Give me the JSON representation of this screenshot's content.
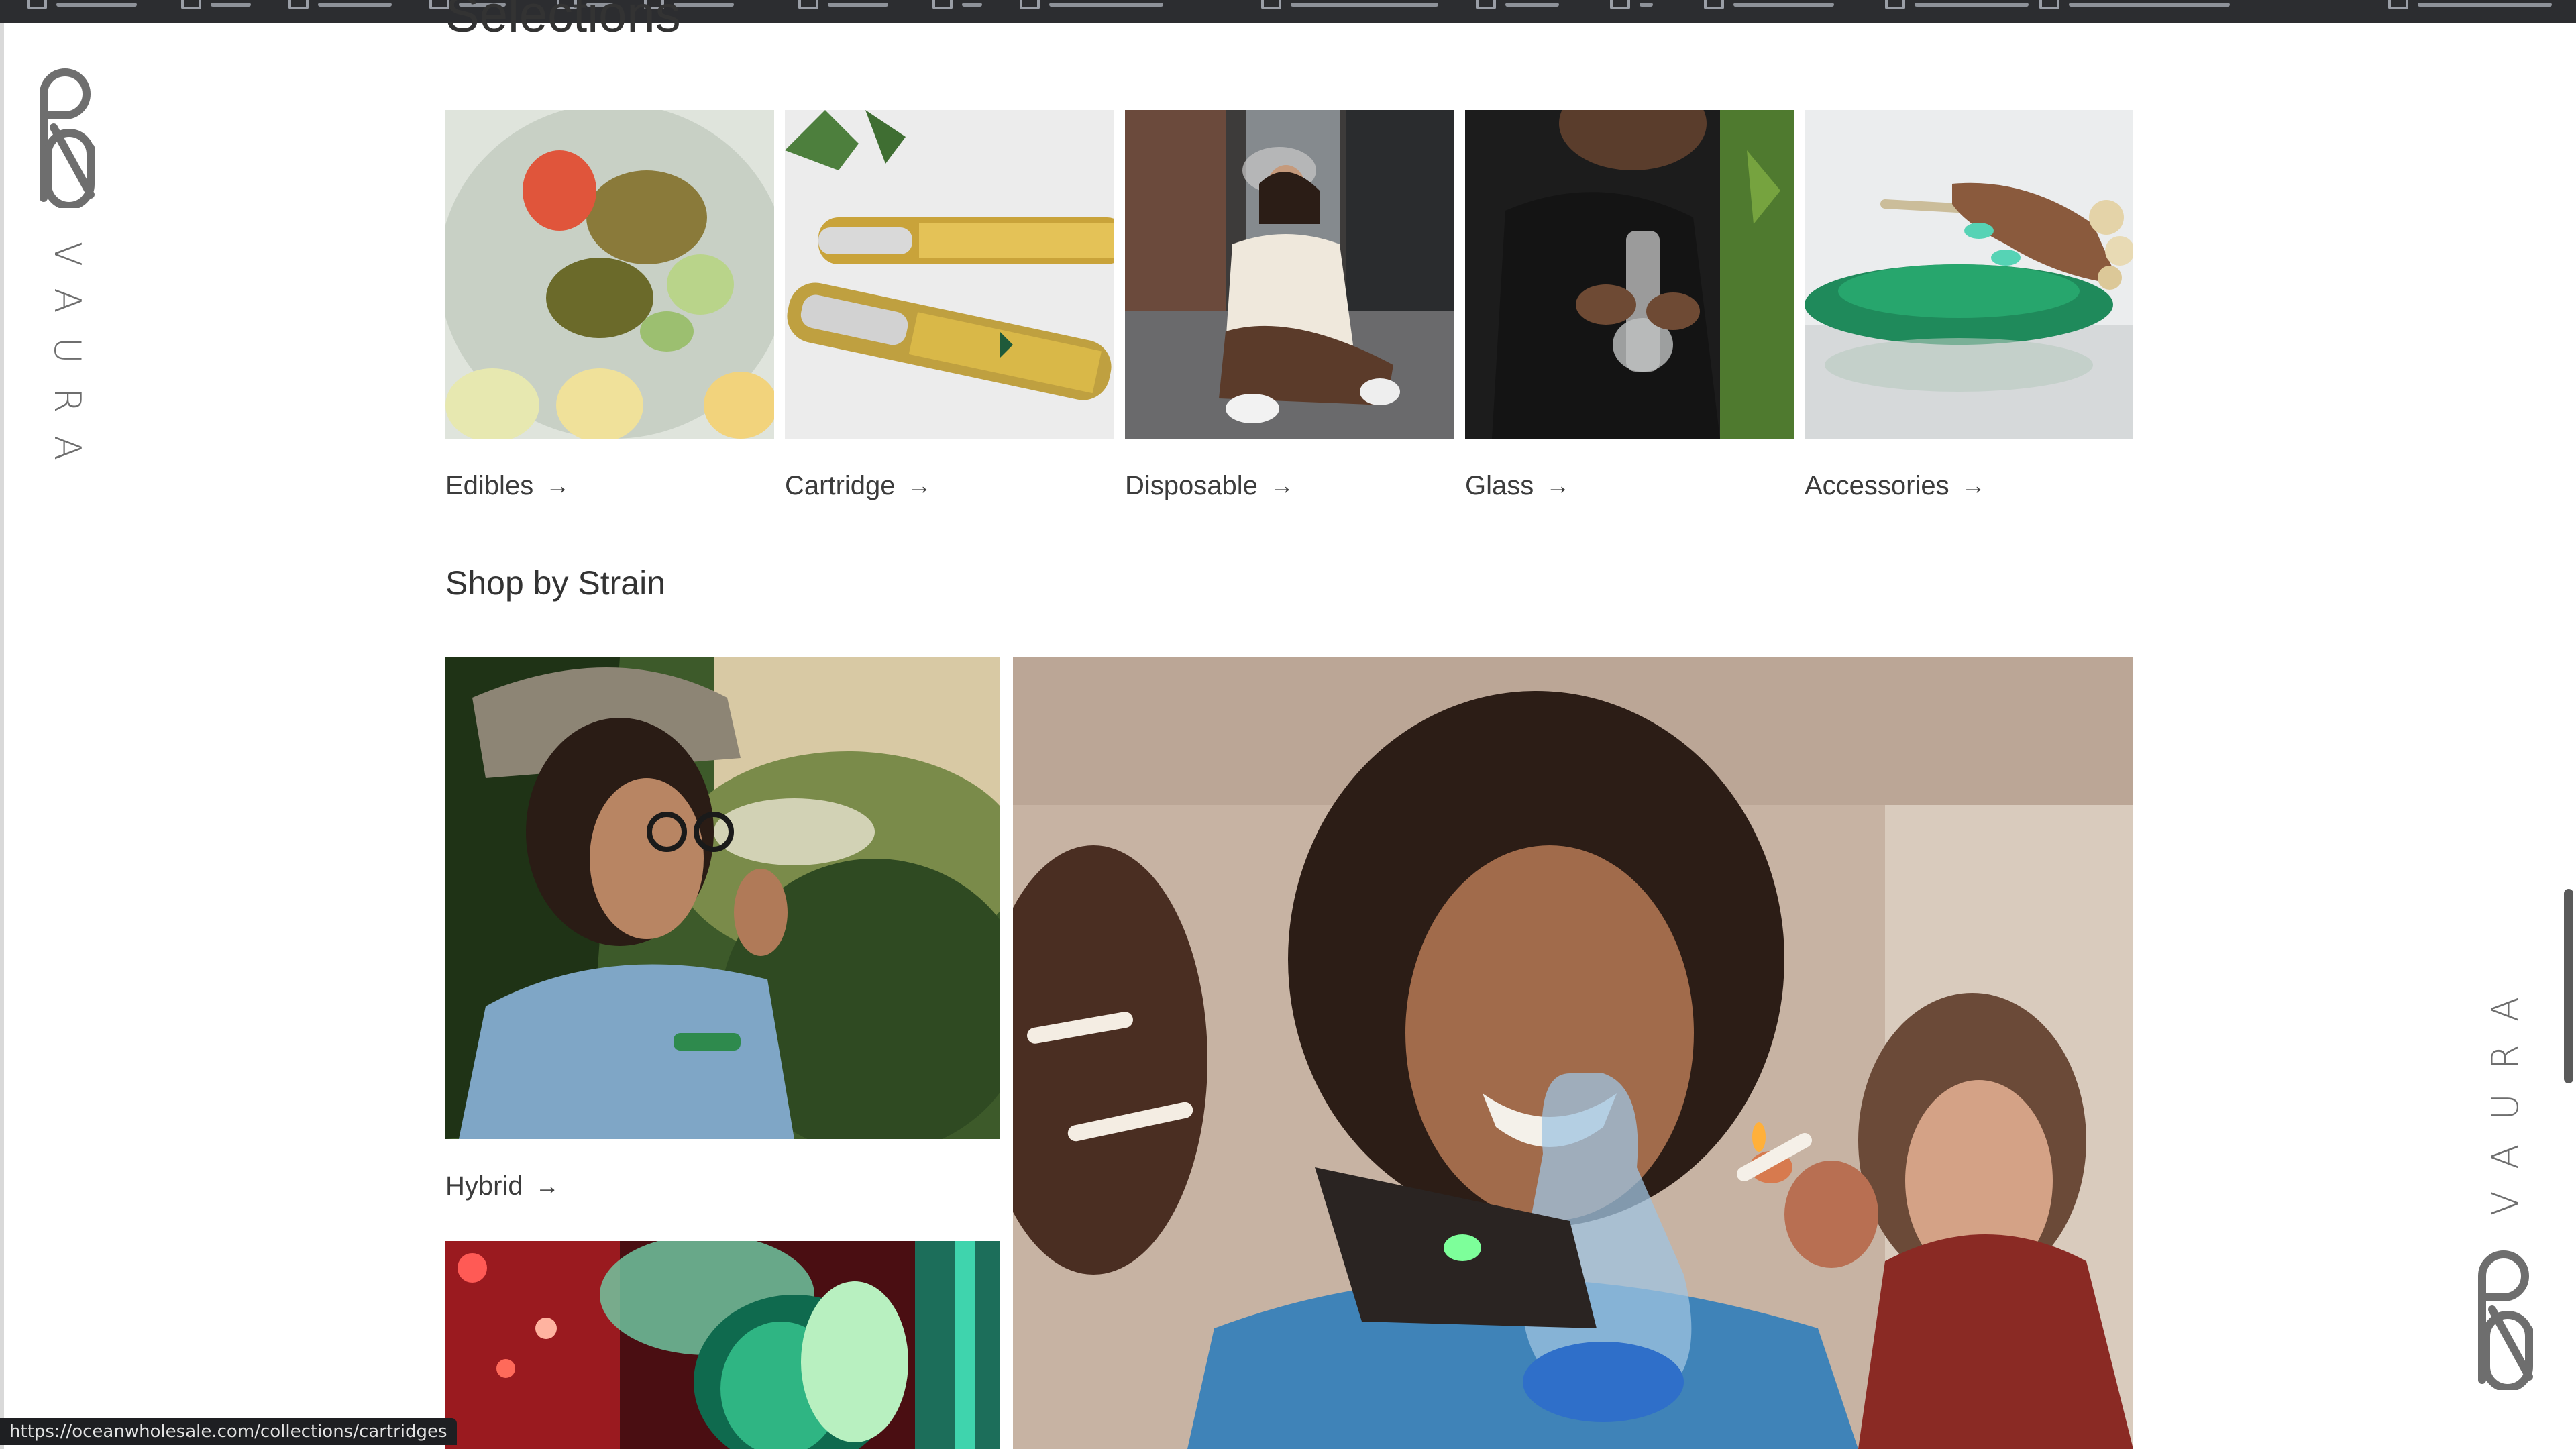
{
  "browser": {
    "bookmarks_bar": {
      "bookmark_count_visible": 16
    },
    "status_url": "https://oceanwholesale.com/collections/cartridges"
  },
  "brand": {
    "name": "VAURA"
  },
  "page": {
    "section_title_cropped": "Selections",
    "collections": [
      {
        "label": "Edibles",
        "image": "edibles-photo"
      },
      {
        "label": "Cartridge",
        "image": "cartridge-photo"
      },
      {
        "label": "Disposable",
        "image": "disposable-photo"
      },
      {
        "label": "Glass",
        "image": "glass-photo"
      },
      {
        "label": "Accessories",
        "image": "accessories-photo"
      }
    ],
    "shop_by_strain": {
      "title": "Shop by Strain",
      "hybrid_label": "Hybrid"
    }
  },
  "icons": {
    "arrow": "→"
  },
  "colors": {
    "page_background": "#ffffff",
    "text": "#333333",
    "bookmarks_bar": "#2c2d30",
    "status_bar": "#1e1f22"
  }
}
